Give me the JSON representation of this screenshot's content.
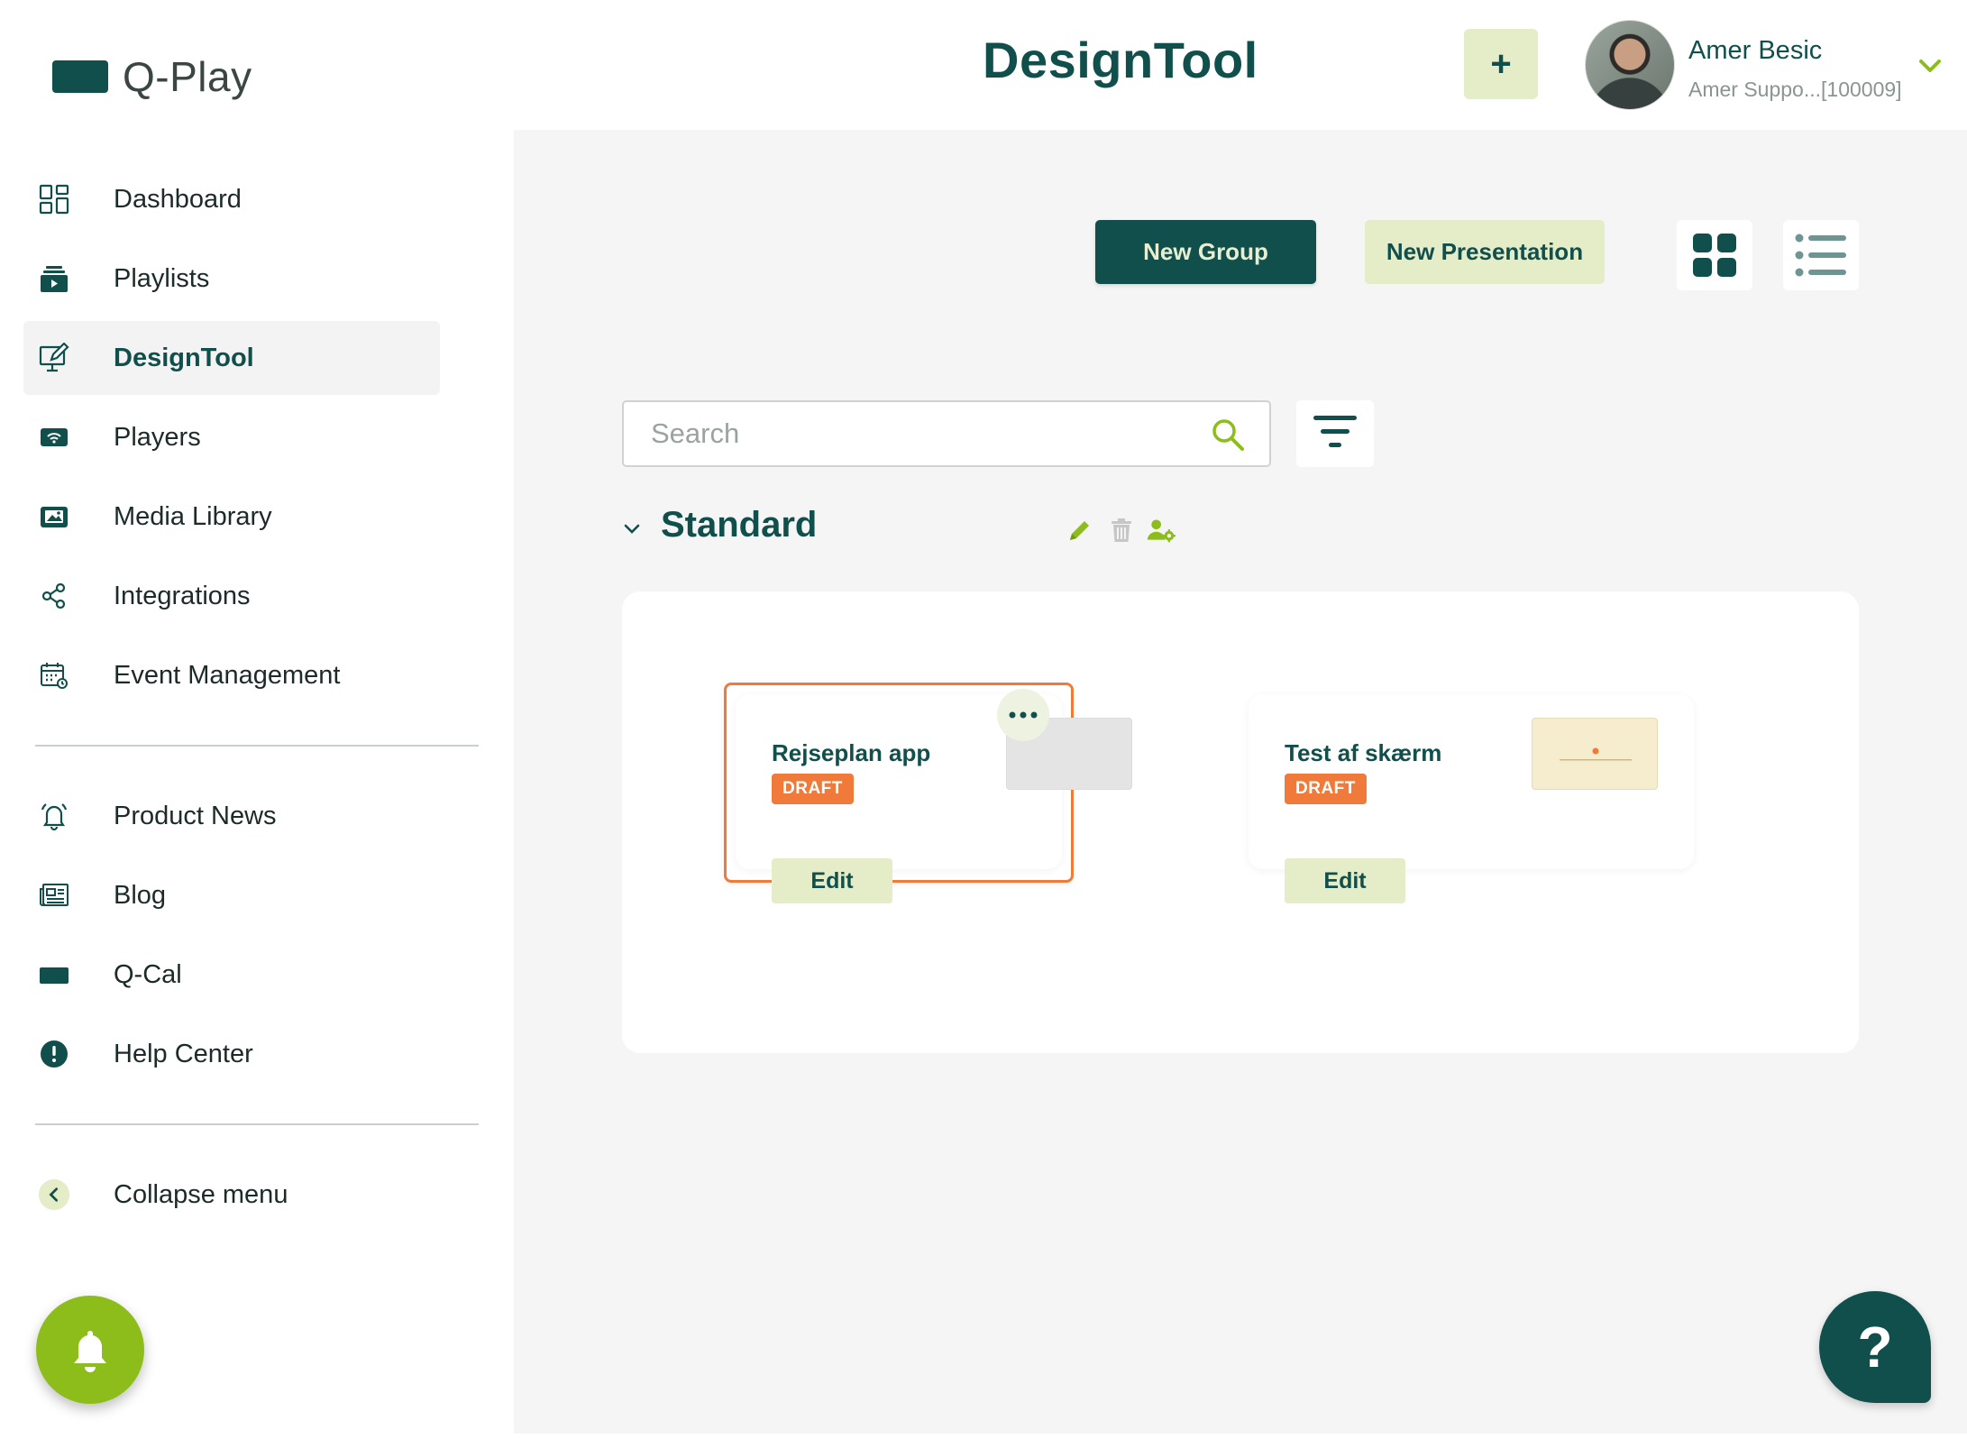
{
  "brand": {
    "name": "Q-Play"
  },
  "sidebar": {
    "items": [
      {
        "label": "Dashboard",
        "icon": "dashboard-icon",
        "active": false
      },
      {
        "label": "Playlists",
        "icon": "playlist-icon",
        "active": false
      },
      {
        "label": "DesignTool",
        "icon": "design-tool-icon",
        "active": true
      },
      {
        "label": "Players",
        "icon": "players-icon",
        "active": false
      },
      {
        "label": "Media Library",
        "icon": "media-library-icon",
        "active": false
      },
      {
        "label": "Integrations",
        "icon": "share-icon",
        "active": false
      },
      {
        "label": "Event Management",
        "icon": "calendar-icon",
        "active": false
      }
    ],
    "secondary": [
      {
        "label": "Product News",
        "icon": "bell-alert-icon"
      },
      {
        "label": "Blog",
        "icon": "newspaper-icon"
      },
      {
        "label": "Q-Cal",
        "icon": "q-cal-icon"
      },
      {
        "label": "Help Center",
        "icon": "exclamation-circle-icon"
      }
    ],
    "collapse_label": "Collapse menu"
  },
  "header": {
    "title": "DesignTool",
    "add_label": "+",
    "user": {
      "name": "Amer Besic",
      "subtitle": "Amer Suppo...[100009]"
    }
  },
  "toolbar": {
    "new_group_label": "New Group",
    "new_presentation_label": "New Presentation",
    "view_mode": "grid"
  },
  "search": {
    "placeholder": "Search",
    "value": ""
  },
  "groups": [
    {
      "name": "Standard",
      "presentations": [
        {
          "title": "Rejseplan app",
          "status": "DRAFT",
          "edit_label": "Edit",
          "selected": true
        },
        {
          "title": "Test af skærm",
          "status": "DRAFT",
          "edit_label": "Edit",
          "selected": false
        }
      ]
    }
  ],
  "help_label": "?",
  "colors": {
    "primary": "#114f4d",
    "accent": "#8dbd1b",
    "pale": "#e4ecc8",
    "draft": "#ef7a3a",
    "selection": "#ef7a3a"
  }
}
